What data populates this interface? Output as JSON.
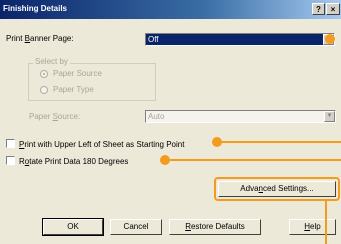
{
  "window": {
    "title": "Finishing Details",
    "help_glyph": "?",
    "close_glyph": "×"
  },
  "banner": {
    "label_pre": "Print ",
    "label_access": "B",
    "label_post": "anner Page:",
    "value": "Off"
  },
  "select_by": {
    "legend": "Select by",
    "options": [
      {
        "label": "Paper Source",
        "selected": true
      },
      {
        "label": "Paper Type",
        "selected": false
      }
    ]
  },
  "paper_source": {
    "label_pre": "Paper ",
    "label_access": "S",
    "label_post": "ource:",
    "value": "Auto"
  },
  "options": {
    "upper_left": {
      "access": "P",
      "rest": "rint with Upper Left of Sheet as Starting Point",
      "checked": false
    },
    "rotate": {
      "pre": "R",
      "access": "o",
      "rest": "tate Print Data 180 Degrees",
      "checked": false
    }
  },
  "buttons": {
    "advanced": {
      "pre": "Adva",
      "access": "n",
      "post": "ced Settings..."
    },
    "ok": "OK",
    "cancel": "Cancel",
    "restore": {
      "access": "R",
      "post": "estore Defaults"
    },
    "help": {
      "access": "H",
      "post": "elp"
    }
  },
  "colors": {
    "accent": "#f39b1f",
    "title_bar": "#0a246a",
    "dialog_bg": "#ece9d8"
  }
}
